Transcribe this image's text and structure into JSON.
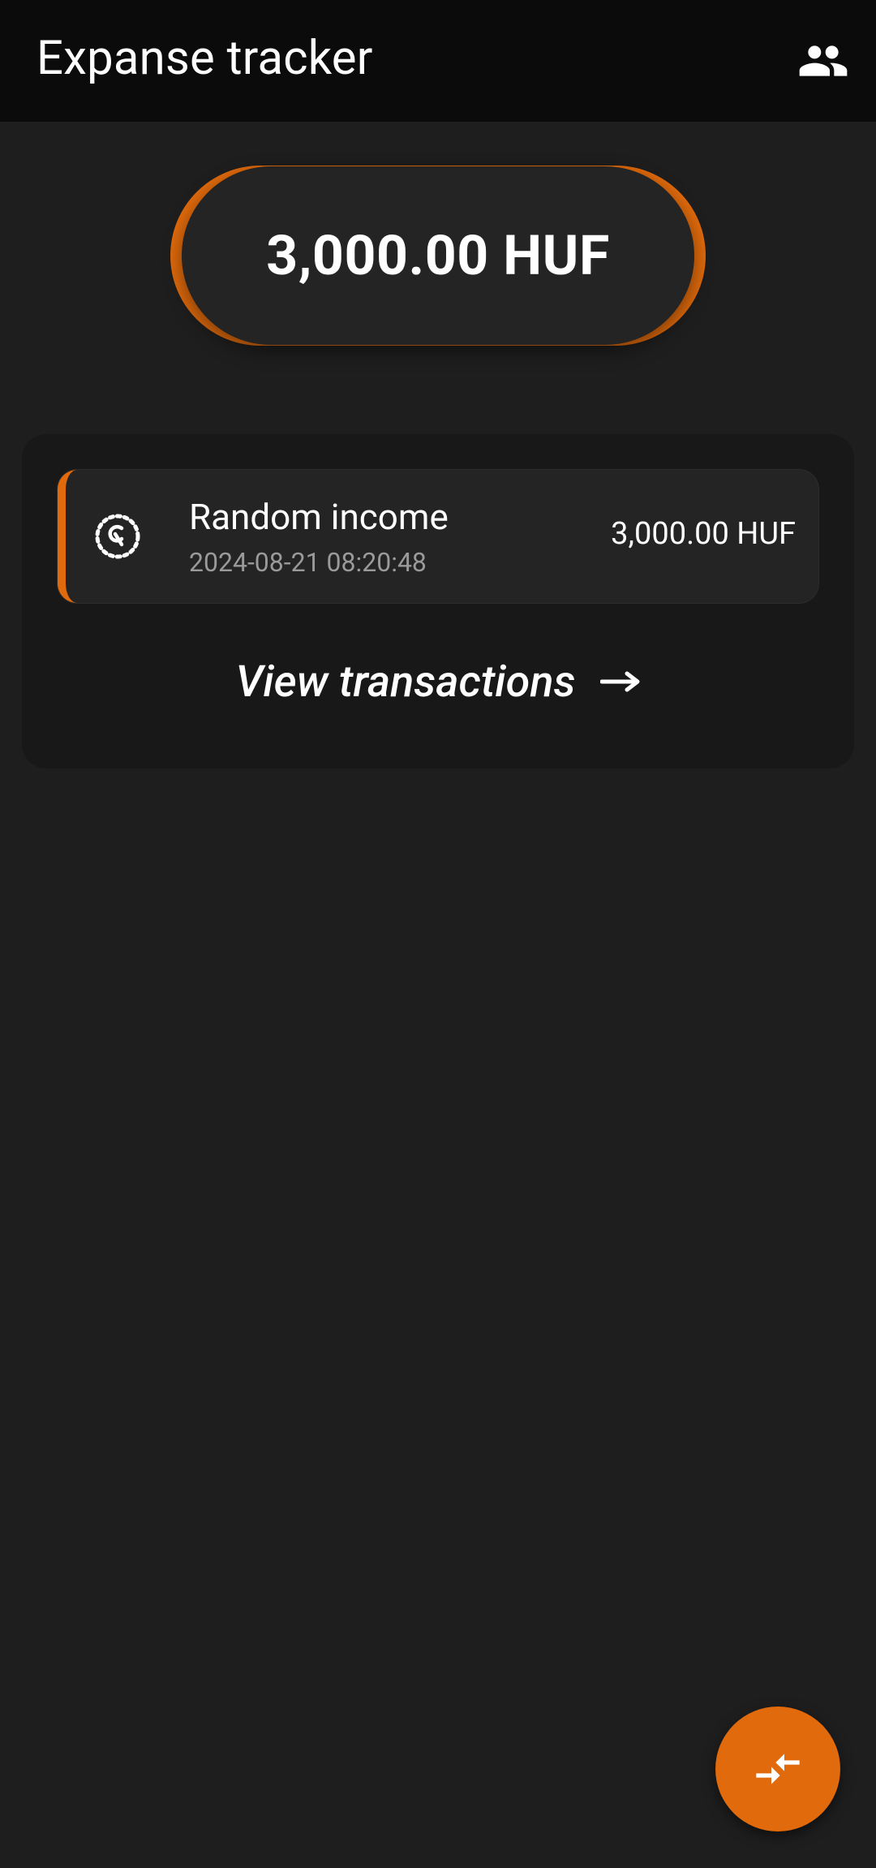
{
  "app": {
    "title": "Expanse tracker",
    "accent_color": "#e06a0c",
    "background_color": "#1e1e1e"
  },
  "header": {
    "profile_icon": "people-icon"
  },
  "balance": {
    "amount": "3,000.00 HUF"
  },
  "recent": {
    "transactions": [
      {
        "title": "Random income",
        "datetime": "2024-08-21 08:20:48",
        "amount": "3,000.00 HUF",
        "icon": "coin-dotted-icon"
      }
    ],
    "view_all_label": "View transactions",
    "view_all_icon": "arrow-right-icon"
  },
  "fab": {
    "icon": "compare-arrows-icon"
  }
}
